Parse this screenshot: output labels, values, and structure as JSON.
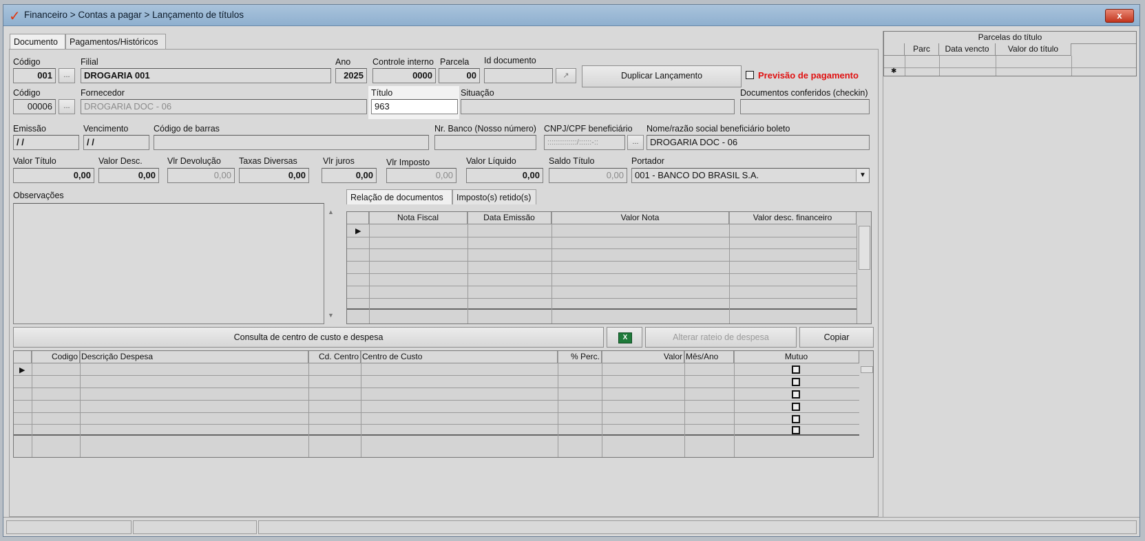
{
  "window": {
    "title": "Financeiro > Contas a pagar > Lançamento de títulos",
    "close_label": "x"
  },
  "tabs": [
    "Documento",
    "Pagamentos/Históricos"
  ],
  "row1": {
    "codigo_label": "Código",
    "codigo_value": "001",
    "lookup_label": "...",
    "filial_label": "Filial",
    "filial_value": "DROGARIA 001",
    "ano_label": "Ano",
    "ano_value": "2025",
    "controle_label": "Controle interno",
    "controle_value": "0000",
    "parcela_label": "Parcela",
    "parcela_value": "00",
    "iddoc_label": "Id documento",
    "iddoc_value": "",
    "duplicar_label": "Duplicar Lançamento",
    "previsao_label": "Previsão de pagamento"
  },
  "row2": {
    "codigo_label": "Código",
    "codigo_value": "00006",
    "fornecedor_label": "Fornecedor",
    "fornecedor_value": "DROGARIA DOC - 06",
    "titulo_label": "Título",
    "titulo_value": "963",
    "situacao_label": "Situação",
    "situacao_value": "",
    "conferidos_label": "Documentos conferidos (checkin)",
    "conferidos_value": ""
  },
  "row3": {
    "emissao_label": "Emissão",
    "emissao_value": "/ /",
    "vencimento_label": "Vencimento",
    "vencimento_value": "/ /",
    "barras_label": "Código de barras",
    "barras_value": "",
    "nrbanco_label": "Nr. Banco (Nosso número)",
    "nrbanco_value": "",
    "cnpj_label": "CNPJ/CPF beneficiário",
    "cnpj_value": "::::::::::::::/::::::-::",
    "nome_label": "Nome/razão social beneficiário boleto",
    "nome_value": "DROGARIA DOC - 06"
  },
  "row4": {
    "valor_titulo_label": "Valor Título",
    "valor_titulo": "0,00",
    "valor_desc_label": "Valor Desc.",
    "valor_desc": "0,00",
    "vlr_devolucao_label": "Vlr Devolução",
    "vlr_devolucao": "0,00",
    "taxas_label": "Taxas Diversas",
    "taxas": "0,00",
    "juros_label": "Vlr juros",
    "juros": "0,00",
    "imposto_label": "Vlr Imposto",
    "imposto": "0,00",
    "liquido_label": "Valor Líquido",
    "liquido": "0,00",
    "saldo_label": "Saldo Título",
    "saldo": "0,00",
    "portador_label": "Portador",
    "portador": "001 - BANCO DO BRASIL S.A."
  },
  "observacoes_label": "Observações",
  "doc_tabs": [
    "Relação de documentos",
    "Imposto(s) retido(s)"
  ],
  "doc_grid": {
    "columns": [
      "Nota Fiscal",
      "Data Emissão",
      "Valor Nota",
      "Valor desc. financeiro"
    ]
  },
  "actions": {
    "consulta_label": "Consulta de centro de custo e despesa",
    "excel_icon": "excel-icon",
    "alterar_label": "Alterar rateio de despesa",
    "copiar_label": "Copiar"
  },
  "cost_grid": {
    "columns": [
      "Codigo",
      "Descrição Despesa",
      "Cd. Centro",
      "Centro de Custo",
      "% Perc.",
      "Valor",
      "Mês/Ano",
      "Mutuo"
    ]
  },
  "parcelas": {
    "title": "Parcelas do título",
    "columns": [
      "Parc",
      "Data vencto",
      "Valor do título"
    ]
  }
}
